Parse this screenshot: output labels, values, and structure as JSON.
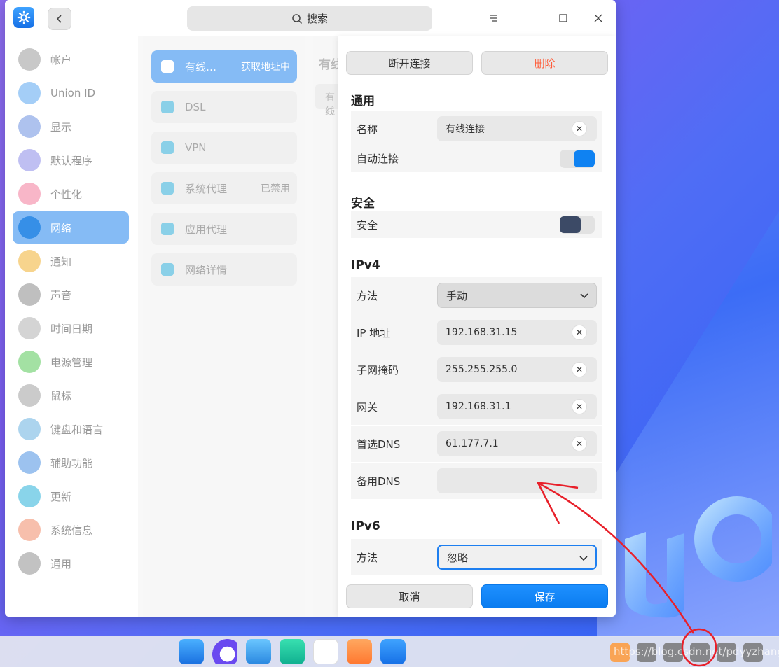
{
  "search": {
    "label": "搜索"
  },
  "sidebar": {
    "items": [
      {
        "label": "帐户",
        "icon": "account-icon",
        "color": "#9a9a9a"
      },
      {
        "label": "Union ID",
        "icon": "cloud-icon",
        "color": "#5aa6f0"
      },
      {
        "label": "显示",
        "icon": "display-icon",
        "color": "#6b8fe0"
      },
      {
        "label": "默认程序",
        "icon": "default-apps-icon",
        "color": "#8a8ae8"
      },
      {
        "label": "个性化",
        "icon": "personalization-icon",
        "color": "#f27a9a"
      },
      {
        "label": "网络",
        "icon": "network-icon",
        "color": "#2e8be6"
      },
      {
        "label": "通知",
        "icon": "bell-icon",
        "color": "#f0b030"
      },
      {
        "label": "声音",
        "icon": "speaker-icon",
        "color": "#8a8a8a"
      },
      {
        "label": "时间日期",
        "icon": "clock-icon",
        "color": "#b0b0b0"
      },
      {
        "label": "电源管理",
        "icon": "battery-icon",
        "color": "#58c858"
      },
      {
        "label": "鼠标",
        "icon": "mouse-icon",
        "color": "#a0a0a0"
      },
      {
        "label": "键盘和语言",
        "icon": "keyboard-icon",
        "color": "#68b0e0"
      },
      {
        "label": "辅助功能",
        "icon": "accessibility-icon",
        "color": "#4a90e2"
      },
      {
        "label": "更新",
        "icon": "update-icon",
        "color": "#28b0d8"
      },
      {
        "label": "系统信息",
        "icon": "system-info-icon",
        "color": "#f08a68"
      },
      {
        "label": "通用",
        "icon": "general-icon",
        "color": "#909090"
      }
    ]
  },
  "network_list": {
    "items": [
      {
        "label": "有线…",
        "right": "获取地址中",
        "icon": "wired-icon"
      },
      {
        "label": "DSL",
        "right": "",
        "icon": "dsl-icon"
      },
      {
        "label": "VPN",
        "right": "",
        "icon": "vpn-icon"
      },
      {
        "label": "系统代理",
        "right": "已禁用",
        "icon": "proxy-icon"
      },
      {
        "label": "应用代理",
        "right": "",
        "icon": "app-proxy-icon"
      },
      {
        "label": "网络详情",
        "right": "",
        "icon": "info-icon"
      }
    ],
    "ghost_title": "有线",
    "ghost_field": "有线"
  },
  "detail": {
    "disconnect": "断开连接",
    "delete": "删除",
    "general_title": "通用",
    "name_label": "名称",
    "name_value": "有线连接",
    "auto_connect_label": "自动连接",
    "auto_connect": true,
    "security_title": "安全",
    "security_label": "安全",
    "security_on": false,
    "ipv4_title": "IPv4",
    "method_label": "方法",
    "ipv4_method": "手动",
    "ip_label": "IP 地址",
    "ip_value": "192.168.31.15",
    "mask_label": "子网掩码",
    "mask_value": "255.255.255.0",
    "gateway_label": "网关",
    "gateway_value": "192.168.31.1",
    "dns1_label": "首选DNS",
    "dns1_value": "61.177.7.1",
    "dns2_label": "备用DNS",
    "dns2_value": "",
    "ipv6_title": "IPv6",
    "ipv6_method_label": "方法",
    "ipv6_method": "忽略",
    "cancel": "取消",
    "save": "保存"
  },
  "colors": {
    "accent": "#1e7ff0",
    "danger": "#ff5a36",
    "annotation": "#e8202a"
  },
  "watermark": "https://blog.csdn.net/pdyyzhang"
}
